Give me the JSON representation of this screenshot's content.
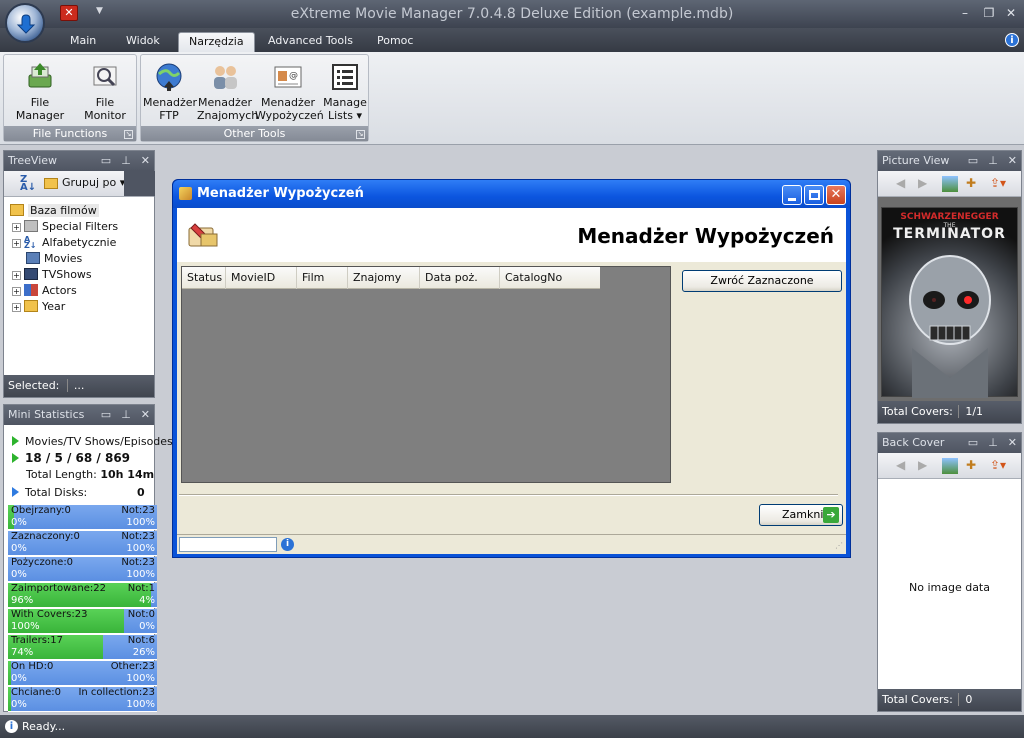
{
  "window": {
    "title": "eXtreme Movie Manager 7.0.4.8 Deluxe Edition (example.mdb)",
    "controls": {
      "minimize": "–",
      "restore": "❐",
      "close": "✕"
    }
  },
  "quick_access": {
    "close_glyph": "✕",
    "dropdown_glyph": "▼"
  },
  "menu_tabs": [
    {
      "label": "Main"
    },
    {
      "label": "Widok"
    },
    {
      "label": "Narzędzia",
      "active": true
    },
    {
      "label": "Advanced Tools"
    },
    {
      "label": "Pomoc"
    }
  ],
  "help_glyph": "i",
  "ribbon": {
    "groups": [
      {
        "label": "File Functions",
        "buttons": [
          {
            "line1": "File Manager",
            "line2": ""
          },
          {
            "line1": "File Monitor",
            "line2": ""
          }
        ]
      },
      {
        "label": "Other Tools",
        "buttons": [
          {
            "line1": "Menadżer",
            "line2": "FTP"
          },
          {
            "line1": "Menadżer",
            "line2": "Znajomych"
          },
          {
            "line1": "Menadżer",
            "line2": "Wypożyczeń"
          },
          {
            "line1": "Manage",
            "line2": "Lists ▾"
          }
        ]
      }
    ]
  },
  "panel_buttons": {
    "float": "▭",
    "pin": "⊥",
    "close": "✕"
  },
  "treeview": {
    "title": "TreeView",
    "group_by": "Grupuj po",
    "expander": "+",
    "root": "Baza filmów",
    "items": [
      {
        "label": "Special Filters",
        "expandable": true
      },
      {
        "label": "Alfabetycznie",
        "expandable": true
      },
      {
        "label": "Movies",
        "expandable": false
      },
      {
        "label": "TVShows",
        "expandable": true
      },
      {
        "label": "Actors",
        "expandable": true
      },
      {
        "label": "Year",
        "expandable": true
      }
    ],
    "footer_label": "Selected:",
    "footer_value": "..."
  },
  "mini_stats": {
    "title": "Mini Statistics",
    "header": "Movies/TV Shows/Episodes",
    "counts": "18 / 5 / 68 / 869",
    "total_length_label": "Total Length:",
    "total_length": "10h 14m",
    "total_disks_label": "Total Disks:",
    "total_disks": "0",
    "bars": [
      {
        "left": "Obejrzany:0",
        "left_pct": "0%",
        "right": "Not:23",
        "right_pct": "100%",
        "fill": 0.04
      },
      {
        "left": "Zaznaczony:0",
        "left_pct": "0%",
        "right": "Not:23",
        "right_pct": "100%",
        "fill": 0.0
      },
      {
        "left": "Pożyczone:0",
        "left_pct": "0%",
        "right": "Not:23",
        "right_pct": "100%",
        "fill": 0.0
      },
      {
        "left": "Zaimportowane:22",
        "left_pct": "96%",
        "right": "Not:1",
        "right_pct": "4%",
        "fill": 0.96
      },
      {
        "left": "With Covers:23",
        "left_pct": "100%",
        "right": "Not:0",
        "right_pct": "0%",
        "fill": 0.78
      },
      {
        "left": "Trailers:17",
        "left_pct": "74%",
        "right": "Not:6",
        "right_pct": "26%",
        "fill": 0.64
      },
      {
        "left": "On HD:0",
        "left_pct": "0%",
        "right": "Other:23",
        "right_pct": "100%",
        "fill": 0.02
      },
      {
        "left": "Chciane:0",
        "left_pct": "0%",
        "right": "In collection:23",
        "right_pct": "100%",
        "fill": 0.02
      }
    ]
  },
  "picture_view": {
    "title": "Picture View",
    "cover": {
      "actor": "SCHWARZENEGGER",
      "the": "THE",
      "movie": "TERMINATOR"
    },
    "footer_label": "Total Covers:",
    "footer_value": "1/1"
  },
  "back_cover": {
    "title": "Back Cover",
    "empty": "No image data",
    "footer_label": "Total Covers:",
    "footer_value": "0"
  },
  "dialog": {
    "title": "Menadżer Wypożyczeń",
    "heading": "Menadżer Wypożyczeń",
    "columns": [
      "Status",
      "MovieID",
      "Film",
      "Znajomy",
      "Data poż.",
      "CatalogNo"
    ],
    "return_button": "Zwróć Zaznaczone",
    "close_button": "Zamknij",
    "status_value": "",
    "info_glyph": "i"
  },
  "statusbar": {
    "text": "Ready...",
    "icon_glyph": "i"
  },
  "colors": {
    "dialog_title": "#0b55df",
    "stat_green": "#39b43a",
    "stat_blue": "#5b8fe2"
  }
}
